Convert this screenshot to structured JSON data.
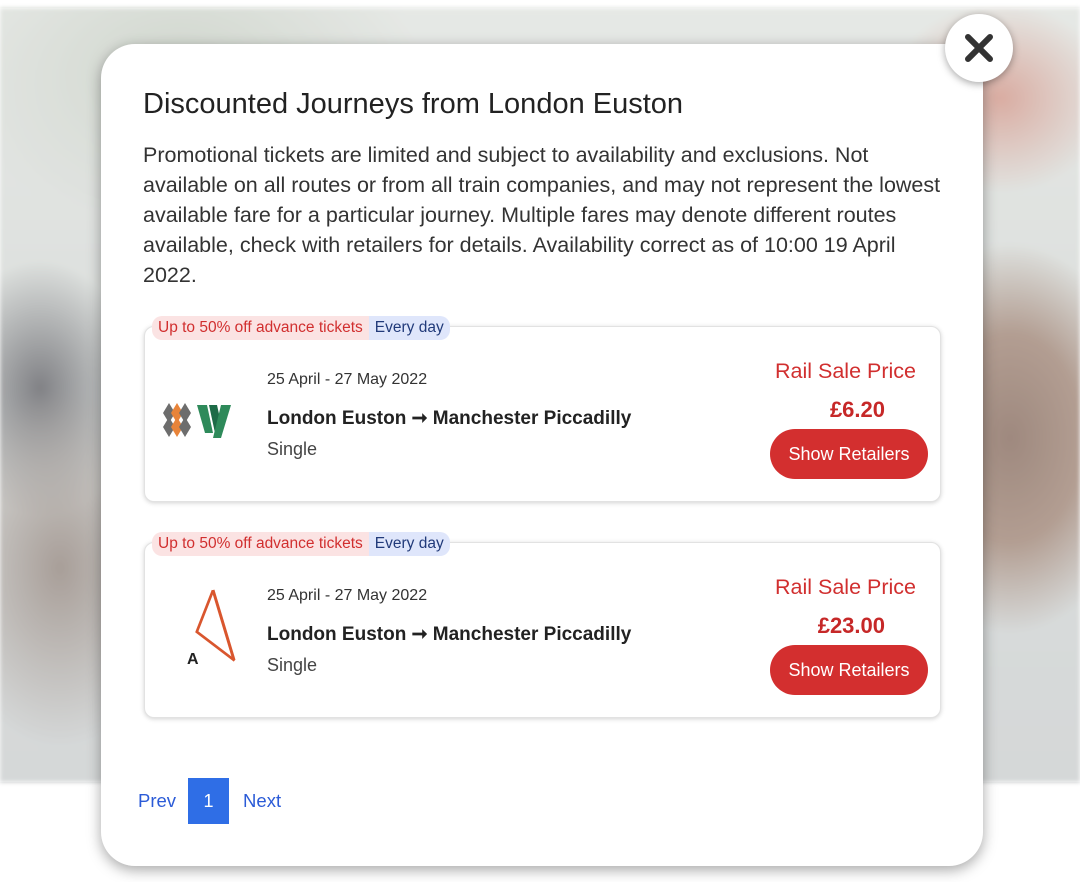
{
  "modal": {
    "title": "Discounted Journeys from London Euston",
    "description": "Promotional tickets are limited and subject to availability and exclusions. Not available on all routes or from all train companies, and may not represent the lowest available fare for a particular journey. Multiple fares may denote different routes available, check with retailers for details. Availability correct as of 10:00 19 April 2022."
  },
  "offers": [
    {
      "tag_discount": "Up to 50% off advance tickets",
      "tag_days": "Every day",
      "operator_logo": "avanti-west-coast-logo",
      "dates": "25 April - 27 May 2022",
      "route": "London Euston ➞ Manchester Piccadilly",
      "ticket_type": "Single",
      "price_label": "Rail Sale Price",
      "price": "£6.20",
      "button_label": "Show Retailers"
    },
    {
      "tag_discount": "Up to 50% off advance tickets",
      "tag_days": "Every day",
      "operator_logo": "avanti-triangle-logo",
      "logo_letter": "A",
      "dates": "25 April - 27 May 2022",
      "route": "London Euston ➞ Manchester Piccadilly",
      "ticket_type": "Single",
      "price_label": "Rail Sale Price",
      "price": "£23.00",
      "button_label": "Show Retailers"
    }
  ],
  "pagination": {
    "prev_label": "Prev",
    "current_page": "1",
    "next_label": "Next"
  },
  "colors": {
    "accent_red": "#d32f2f",
    "page_blue": "#2f6ee6",
    "link_blue": "#2b5bd7"
  }
}
